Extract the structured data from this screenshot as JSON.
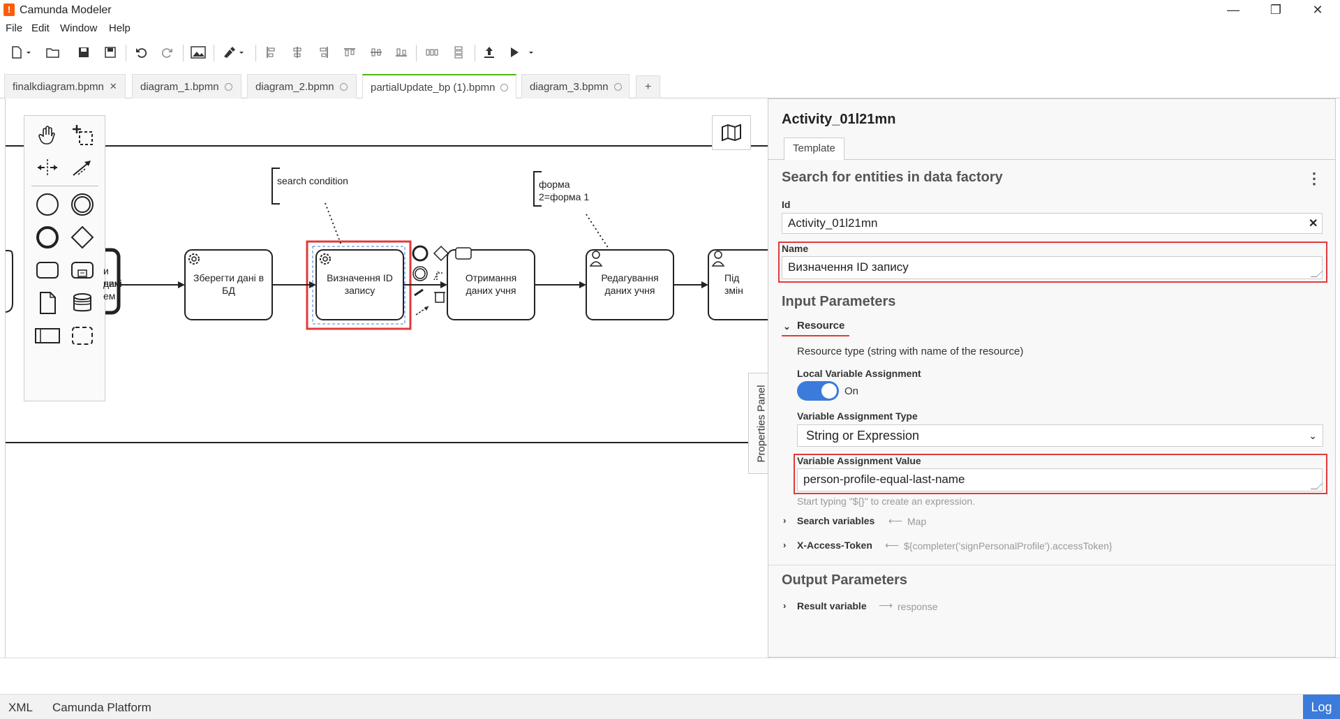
{
  "window": {
    "title": "Camunda Modeler",
    "logo_char": "!",
    "minimize": "—",
    "maximize": "❐",
    "close": "✕"
  },
  "menu": [
    "File",
    "Edit",
    "Window",
    "Help"
  ],
  "tabs": [
    {
      "label": "finalkdiagram.bpmn",
      "state": "close"
    },
    {
      "label": "diagram_1.bpmn",
      "state": "saved"
    },
    {
      "label": "diagram_2.bpmn",
      "state": "saved"
    },
    {
      "label": "partialUpdate_bp (1).bpmn",
      "state": "saved",
      "active": true
    },
    {
      "label": "diagram_3.bpmn",
      "state": "saved"
    }
  ],
  "tab_add": "+",
  "diagram": {
    "task_partial_top": "и дані",
    "task_partial_mid": "ним",
    "task_partial_bot": "ем",
    "task_save": "Зберегти дані в БД",
    "task_define_id": "Визначення ID запису",
    "task_receive": "Отримання даних учня",
    "task_edit": "Редагування даних учня",
    "task_partial_right_1": "Під",
    "task_partial_right_2": "змін",
    "annotation_1": "search condition",
    "annotation_2": "форма\n2=форма 1"
  },
  "properties_toggle": "Properties Panel",
  "properties": {
    "element_id_title": "Activity_01l21mn",
    "tab_template": "Template",
    "template_title": "Search for entities in data factory",
    "id_label": "Id",
    "id_value": "Activity_01l21mn",
    "id_clear": "✕",
    "name_label": "Name",
    "name_value": "Визначення ID запису",
    "input_params_title": "Input Parameters",
    "resource_title": "Resource",
    "resource_desc": "Resource type (string with name of the resource)",
    "local_var_label": "Local Variable Assignment",
    "local_var_state": "On",
    "var_type_label": "Variable Assignment Type",
    "var_type_value": "String or Expression",
    "var_value_label": "Variable Assignment Value",
    "var_value": "person-profile-equal-last-name",
    "var_hint": "Start typing \"${}\" to create an expression.",
    "search_vars_label": "Search variables",
    "search_vars_value": "Map",
    "xtoken_label": "X-Access-Token",
    "xtoken_value": "${completer('signPersonalProfile').accessToken}",
    "output_params_title": "Output Parameters",
    "result_var_label": "Result variable",
    "result_var_value": "response"
  },
  "status": {
    "xml": "XML",
    "platform": "Camunda Platform",
    "log": "Log"
  },
  "colors": {
    "accent_blue": "#3a7bdb",
    "highlight_red": "#e23a3a",
    "active_tab_green": "#52b415",
    "logo_orange": "#fc5d0d"
  }
}
